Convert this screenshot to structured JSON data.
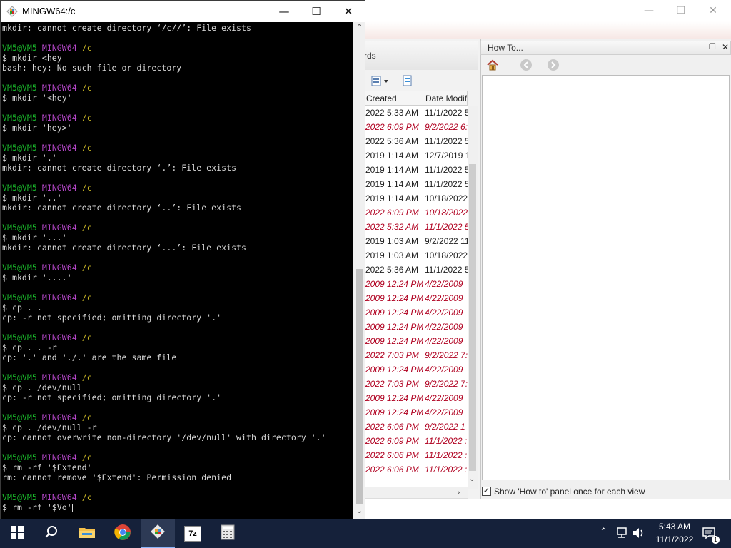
{
  "background_window": {
    "tab_label": "rds",
    "column_headers": [
      "Created",
      "Date Modif"
    ],
    "rows": [
      {
        "created": "2022 5:33 AM",
        "modified": "11/1/2022 5",
        "style": "norm"
      },
      {
        "created": "2022 6:09 PM",
        "modified": "9/2/2022 6:",
        "style": "red"
      },
      {
        "created": "2022 5:36 AM",
        "modified": "11/1/2022 5",
        "style": "norm"
      },
      {
        "created": "2019 1:14 AM",
        "modified": "12/7/2019 1",
        "style": "norm"
      },
      {
        "created": "2019 1:14 AM",
        "modified": "11/1/2022 5",
        "style": "norm"
      },
      {
        "created": "2019 1:14 AM",
        "modified": "11/1/2022 5",
        "style": "norm"
      },
      {
        "created": "2019 1:14 AM",
        "modified": "10/18/2022",
        "style": "norm"
      },
      {
        "created": "2022 6:09 PM",
        "modified": "10/18/2022",
        "style": "red"
      },
      {
        "created": "2022 5:32 AM",
        "modified": "11/1/2022 5",
        "style": "red"
      },
      {
        "created": "2019 1:03 AM",
        "modified": "9/2/2022 11",
        "style": "norm"
      },
      {
        "created": "2019 1:03 AM",
        "modified": "10/18/2022",
        "style": "norm"
      },
      {
        "created": "2022 5:36 AM",
        "modified": "11/1/2022 5",
        "style": "norm"
      },
      {
        "created": "2009 12:24 PM",
        "modified": "4/22/2009",
        "style": "red"
      },
      {
        "created": "2009 12:24 PM",
        "modified": "4/22/2009",
        "style": "red"
      },
      {
        "created": "2009 12:24 PM",
        "modified": "4/22/2009",
        "style": "red"
      },
      {
        "created": "2009 12:24 PM",
        "modified": "4/22/2009",
        "style": "red"
      },
      {
        "created": "2009 12:24 PM",
        "modified": "4/22/2009",
        "style": "red"
      },
      {
        "created": "2022 7:03 PM",
        "modified": "9/2/2022 7:",
        "style": "red"
      },
      {
        "created": "2009 12:24 PM",
        "modified": "4/22/2009",
        "style": "red"
      },
      {
        "created": "2022 7:03 PM",
        "modified": "9/2/2022 7:",
        "style": "red"
      },
      {
        "created": "2009 12:24 PM",
        "modified": "4/22/2009",
        "style": "red"
      },
      {
        "created": "2009 12:24 PM",
        "modified": "4/22/2009",
        "style": "red"
      },
      {
        "created": "2022 6:06 PM",
        "modified": "9/2/2022 1",
        "style": "red"
      },
      {
        "created": "2022 6:09 PM",
        "modified": "11/1/2022 :",
        "style": "red"
      },
      {
        "created": "2022 6:06 PM",
        "modified": "11/1/2022 :",
        "style": "red"
      },
      {
        "created": "2022 6:06 PM",
        "modified": "11/1/2022 :",
        "style": "red"
      }
    ]
  },
  "howto_panel": {
    "title": "How To...",
    "checkbox_label": "Show 'How to' panel once for each view",
    "checkbox_checked": true
  },
  "terminal": {
    "title": "MINGW64:/c",
    "prompt_user": "VM5@VM5",
    "prompt_shell": "MINGW64",
    "prompt_path": "/c",
    "colors": {
      "user": "#19b52a",
      "shell": "#b547c9",
      "path": "#c9b724",
      "text": "#d8d8d8"
    },
    "lines": [
      {
        "type": "text",
        "text": "mkdir: cannot create directory ‘/c//’: File exists"
      },
      {
        "type": "blank"
      },
      {
        "type": "prompt"
      },
      {
        "type": "text",
        "text": "$ mkdir <hey"
      },
      {
        "type": "text",
        "text": "bash: hey: No such file or directory"
      },
      {
        "type": "blank"
      },
      {
        "type": "prompt"
      },
      {
        "type": "text",
        "text": "$ mkdir '<hey'"
      },
      {
        "type": "blank"
      },
      {
        "type": "prompt"
      },
      {
        "type": "text",
        "text": "$ mkdir 'hey>'"
      },
      {
        "type": "blank"
      },
      {
        "type": "prompt"
      },
      {
        "type": "text",
        "text": "$ mkdir '.'"
      },
      {
        "type": "text",
        "text": "mkdir: cannot create directory ‘.’: File exists"
      },
      {
        "type": "blank"
      },
      {
        "type": "prompt"
      },
      {
        "type": "text",
        "text": "$ mkdir '..'"
      },
      {
        "type": "text",
        "text": "mkdir: cannot create directory ‘..’: File exists"
      },
      {
        "type": "blank"
      },
      {
        "type": "prompt"
      },
      {
        "type": "text",
        "text": "$ mkdir '...'"
      },
      {
        "type": "text",
        "text": "mkdir: cannot create directory ‘...’: File exists"
      },
      {
        "type": "blank"
      },
      {
        "type": "prompt"
      },
      {
        "type": "text",
        "text": "$ mkdir '....'"
      },
      {
        "type": "blank"
      },
      {
        "type": "prompt"
      },
      {
        "type": "text",
        "text": "$ cp . ."
      },
      {
        "type": "text",
        "text": "cp: -r not specified; omitting directory '.'"
      },
      {
        "type": "blank"
      },
      {
        "type": "prompt"
      },
      {
        "type": "text",
        "text": "$ cp . . -r"
      },
      {
        "type": "text",
        "text": "cp: '.' and './.' are the same file"
      },
      {
        "type": "blank"
      },
      {
        "type": "prompt"
      },
      {
        "type": "text",
        "text": "$ cp . /dev/null"
      },
      {
        "type": "text",
        "text": "cp: -r not specified; omitting directory '.'"
      },
      {
        "type": "blank"
      },
      {
        "type": "prompt"
      },
      {
        "type": "text",
        "text": "$ cp . /dev/null -r"
      },
      {
        "type": "text",
        "text": "cp: cannot overwrite non-directory '/dev/null' with directory '.'"
      },
      {
        "type": "blank"
      },
      {
        "type": "prompt"
      },
      {
        "type": "text",
        "text": "$ rm -rf '$Extend'"
      },
      {
        "type": "text",
        "text": "rm: cannot remove '$Extend': Permission denied"
      },
      {
        "type": "blank"
      },
      {
        "type": "prompt"
      },
      {
        "type": "text",
        "text": "$ rm -rf '$Vo'"
      }
    ]
  },
  "taskbar": {
    "apps": [
      {
        "name": "start",
        "icon": "windows-logo-icon"
      },
      {
        "name": "search",
        "icon": "search-icon"
      },
      {
        "name": "file-explorer",
        "icon": "folder-icon"
      },
      {
        "name": "chrome",
        "icon": "chrome-icon"
      },
      {
        "name": "git-bash",
        "icon": "git-bash-icon",
        "active": true
      },
      {
        "name": "7zip",
        "icon": "7z-icon",
        "label": "7z"
      },
      {
        "name": "calculator",
        "icon": "calculator-icon"
      }
    ],
    "time": "5:43 AM",
    "date": "11/1/2022"
  }
}
